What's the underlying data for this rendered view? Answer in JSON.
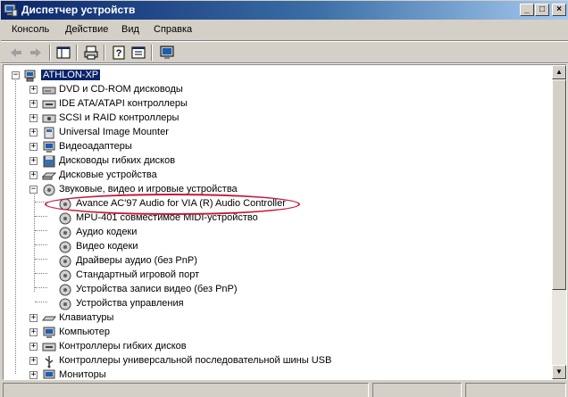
{
  "window": {
    "title": "Диспетчер устройств",
    "controls": {
      "minimize": "_",
      "maximize": "□",
      "close": "×"
    }
  },
  "menu": {
    "items": [
      "Консоль",
      "Действие",
      "Вид",
      "Справка"
    ]
  },
  "toolbar": {
    "icons": [
      "back-arrow-icon",
      "forward-arrow-icon",
      "show-hide-tree-icon",
      "print-icon",
      "help-icon",
      "properties-icon",
      "update-driver-icon",
      "scan-hardware-icon"
    ]
  },
  "tree": {
    "root": {
      "label": "ATHLON-XP",
      "expander": "−"
    },
    "categories": [
      {
        "label": "DVD и CD-ROM дисководы",
        "expander": "+",
        "icon": "cdrom-icon"
      },
      {
        "label": "IDE ATA/ATAPI контроллеры",
        "expander": "+",
        "icon": "ide-controller-icon"
      },
      {
        "label": "SCSI и RAID контроллеры",
        "expander": "+",
        "icon": "scsi-controller-icon"
      },
      {
        "label": "Universal Image Mounter",
        "expander": "+",
        "icon": "image-mounter-icon"
      },
      {
        "label": "Видеоадаптеры",
        "expander": "+",
        "icon": "display-adapter-icon"
      },
      {
        "label": "Дисководы гибких дисков",
        "expander": "+",
        "icon": "floppy-drive-icon"
      },
      {
        "label": "Дисковые устройства",
        "expander": "+",
        "icon": "disk-drive-icon"
      },
      {
        "label": "Звуковые, видео и игровые устройства",
        "expander": "−",
        "icon": "sound-video-game-icon"
      }
    ],
    "sound_children": [
      {
        "label": "Avance AC'97 Audio for VIA (R) Audio Controller",
        "icon": "audio-device-icon"
      },
      {
        "label": "MPU-401 совместимое MIDI-устройство",
        "icon": "audio-device-icon"
      },
      {
        "label": "Аудио кодеки",
        "icon": "audio-device-icon"
      },
      {
        "label": "Видео кодеки",
        "icon": "audio-device-icon"
      },
      {
        "label": "Драйверы аудио (без PnP)",
        "icon": "audio-device-icon"
      },
      {
        "label": "Стандартный игровой порт",
        "icon": "audio-device-icon"
      },
      {
        "label": "Устройства записи видео (без PnP)",
        "icon": "audio-device-icon"
      },
      {
        "label": "Устройства управления",
        "icon": "audio-device-icon"
      }
    ],
    "more_categories": [
      {
        "label": "Клавиатуры",
        "expander": "+",
        "icon": "keyboard-icon"
      },
      {
        "label": "Компьютер",
        "expander": "+",
        "icon": "computer-icon"
      },
      {
        "label": "Контроллеры гибких дисков",
        "expander": "+",
        "icon": "floppy-controller-icon"
      },
      {
        "label": "Контроллеры универсальной последовательной шины USB",
        "expander": "+",
        "icon": "usb-controller-icon"
      },
      {
        "label": "Мониторы",
        "expander": "+",
        "icon": "monitor-icon"
      }
    ]
  },
  "colors": {
    "title_gradient_start": "#0a246a",
    "title_gradient_end": "#a6caf0",
    "selection": "#0a246a",
    "highlight_ellipse": "#c41a3a",
    "face": "#d4d0c8"
  }
}
